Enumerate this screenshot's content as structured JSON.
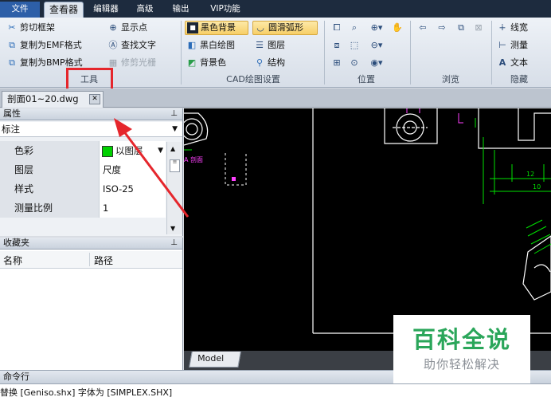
{
  "menu": {
    "tabs": [
      "文件",
      "查看器",
      "编辑器",
      "高级",
      "输出",
      "VIP功能"
    ]
  },
  "ribbon": {
    "tools": {
      "label": "工具",
      "items": [
        "剪切框架",
        "复制为EMF格式",
        "复制为BMP格式",
        "显示点",
        "查找文字",
        "修剪光栅"
      ]
    },
    "cad": {
      "label": "CAD绘图设置",
      "items": [
        "黑色背景",
        "黑白绘图",
        "背景色",
        "圆滑弧形",
        "图层",
        "结构"
      ]
    },
    "position": {
      "label": "位置"
    },
    "browse": {
      "label": "浏览"
    },
    "hide": {
      "label": "隐藏",
      "items": [
        "线宽",
        "测量",
        "文本"
      ]
    }
  },
  "document_tab": {
    "title": "剖面01~20.dwg"
  },
  "properties": {
    "title": "属性",
    "category": "标注",
    "rows": [
      {
        "key": "色彩",
        "value": "以图层"
      },
      {
        "key": "图层",
        "value": "尺度"
      },
      {
        "key": "样式",
        "value": "ISO-25"
      },
      {
        "key": "测量比例",
        "value": "1"
      }
    ]
  },
  "favorites": {
    "title": "收藏夹",
    "columns": [
      "名称",
      "路径"
    ]
  },
  "canvas": {
    "labels": [
      "A 剖面",
      "12",
      "10"
    ],
    "model_tab": "Model"
  },
  "command": {
    "title": "命令行",
    "output": "替换 [Geniso.shx] 字体为 [SIMPLEX.SHX]"
  },
  "watermark": {
    "main": "百科全说",
    "sub": "助你轻松解决"
  },
  "colors": {
    "menubar": "#1d2b3e",
    "highlight": "#e5262c",
    "drawing_line": "#ffffff",
    "dimension": "#00e000",
    "annotation": "#ff40ff",
    "watermark": "#2aa65a"
  }
}
